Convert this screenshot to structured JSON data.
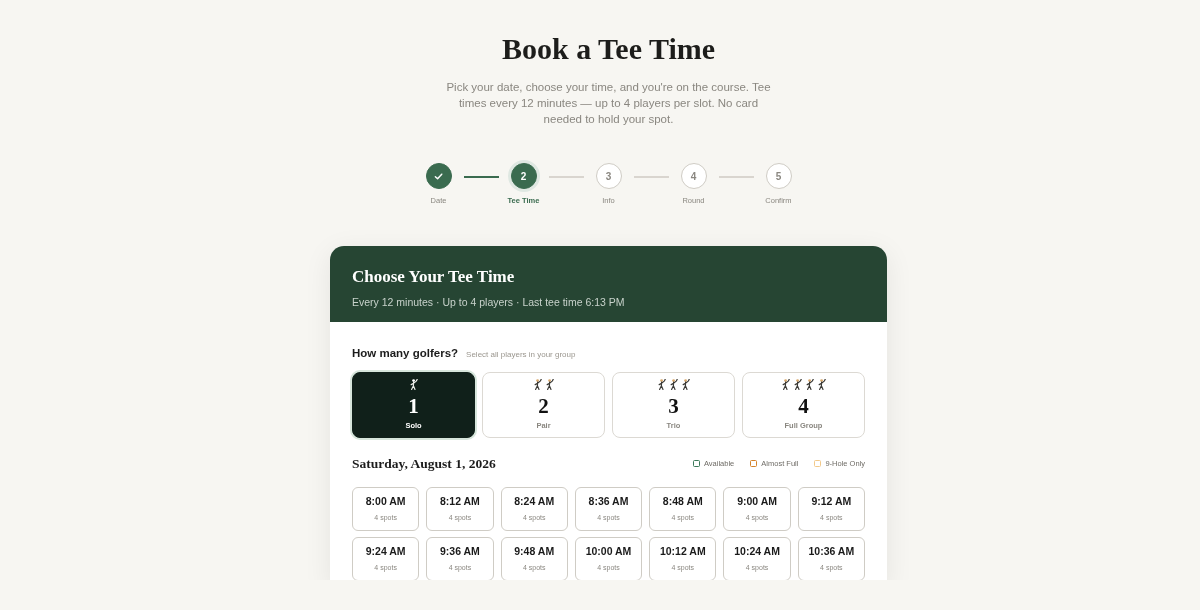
{
  "page": {
    "title": "Book a Tee Time",
    "subtitle": "Pick your date, choose your time, and you're on the course. Tee times every 12 minutes — up to 4 players per slot. No card needed to hold your spot."
  },
  "steps": [
    {
      "label": "Date",
      "done": true,
      "selected": false
    },
    {
      "number": "2",
      "label": "Tee Time",
      "done": false,
      "selected": true
    },
    {
      "number": "3",
      "label": "Info",
      "done": false,
      "selected": false
    },
    {
      "number": "4",
      "label": "Round",
      "done": false,
      "selected": false
    },
    {
      "number": "5",
      "label": "Confirm",
      "done": false,
      "selected": false
    }
  ],
  "panel": {
    "title": "Choose Your Tee Time",
    "subtitle": "Every 12 minutes · Up to 4 players · Last tee time 6:13 PM"
  },
  "golfers": {
    "question": "How many golfers?",
    "hint": "Select all players in your group",
    "options": [
      {
        "count": "1",
        "label": "Solo",
        "selected": true
      },
      {
        "count": "2",
        "label": "Pair",
        "selected": false
      },
      {
        "count": "3",
        "label": "Trio",
        "selected": false
      },
      {
        "count": "4",
        "label": "Full Group",
        "selected": false
      }
    ]
  },
  "schedule": {
    "date": "Saturday, August 1, 2026",
    "legend": [
      {
        "label": "Available",
        "color": "#3d7a5a"
      },
      {
        "label": "Almost Full",
        "color": "#d4822a"
      },
      {
        "label": "9-Hole Only",
        "color": "#f2c98a"
      }
    ],
    "slots": [
      {
        "time": "8:00 AM",
        "spots": "4 spots"
      },
      {
        "time": "8:12 AM",
        "spots": "4 spots"
      },
      {
        "time": "8:24 AM",
        "spots": "4 spots"
      },
      {
        "time": "8:36 AM",
        "spots": "4 spots"
      },
      {
        "time": "8:48 AM",
        "spots": "4 spots"
      },
      {
        "time": "9:00 AM",
        "spots": "4 spots"
      },
      {
        "time": "9:12 AM",
        "spots": "4 spots"
      },
      {
        "time": "9:24 AM",
        "spots": "4 spots"
      },
      {
        "time": "9:36 AM",
        "spots": "4 spots"
      },
      {
        "time": "9:48 AM",
        "spots": "4 spots"
      },
      {
        "time": "10:00 AM",
        "spots": "4 spots"
      },
      {
        "time": "10:12 AM",
        "spots": "4 spots"
      },
      {
        "time": "10:24 AM",
        "spots": "4 spots"
      },
      {
        "time": "10:36 AM",
        "spots": "4 spots"
      }
    ]
  }
}
